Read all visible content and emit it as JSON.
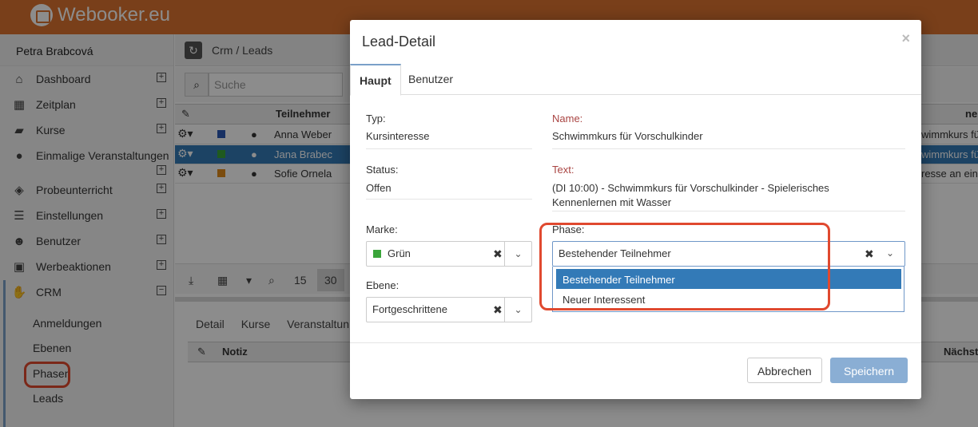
{
  "app": {
    "logo_text": "Webooker.eu"
  },
  "sidebar": {
    "user_name": "Petra Brabcová",
    "items": [
      {
        "label": "Dashboard",
        "icon": "home-icon"
      },
      {
        "label": "Zeitplan",
        "icon": "calendar-icon"
      },
      {
        "label": "Kurse",
        "icon": "book-icon"
      },
      {
        "label": "Einmalige Veranstaltungen",
        "icon": "soccer-ball-icon"
      },
      {
        "label": "Probeunterricht",
        "icon": "eye-slash-icon"
      },
      {
        "label": "Einstellungen",
        "icon": "list-icon"
      },
      {
        "label": "Benutzer",
        "icon": "users-icon"
      },
      {
        "label": "Werbeaktionen",
        "icon": "gift-icon"
      },
      {
        "label": "CRM",
        "icon": "handshake-icon"
      }
    ],
    "crm_subitems": [
      "Anmeldungen",
      "Ebenen",
      "Phasen",
      "Leads"
    ]
  },
  "content": {
    "breadcrumb": "Crm / Leads",
    "search_placeholder": "Suche",
    "grid": {
      "col_participant": "Teilnehmer",
      "col_name_partial": "ne",
      "rows": [
        {
          "name": "Anna Weber",
          "right": "wimmkurs fü",
          "flag_color": "#2a58b5"
        },
        {
          "name": "Jana Brabec",
          "right": "wimmkurs fü",
          "flag_color": "#3aa53a"
        },
        {
          "name": "Sofie Ornela",
          "right": "resse an ein",
          "flag_color": "#e08a1a"
        }
      ]
    },
    "pager": {
      "page_sizes": [
        "15",
        "30"
      ]
    },
    "bottom_tabs": [
      "Detail",
      "Kurse",
      "Veranstaltun"
    ],
    "bottom_grid": {
      "col_note": "Notiz",
      "col_next": "Nächst"
    }
  },
  "modal": {
    "title": "Lead-Detail",
    "close": "×",
    "tabs": [
      "Haupt",
      "Benutzer"
    ],
    "typ_label": "Typ:",
    "typ_value": "Kursinteresse",
    "name_label": "Name:",
    "name_value": "Schwimmkurs für Vorschulkinder",
    "status_label": "Status:",
    "status_value": "Offen",
    "text_label": "Text:",
    "text_value": "(DI 10:00) - Schwimmkurs für Vorschulkinder - Spielerisches Kennenlernen mit Wasser",
    "marke_label": "Marke:",
    "marke_value": "Grün",
    "marke_flag_color": "#3aa53a",
    "ebene_label": "Ebene:",
    "ebene_value": "Fortgeschrittene",
    "phase_label": "Phase:",
    "phase_value": "Bestehender Teilnehmer",
    "phase_options": [
      "Bestehender Teilnehmer",
      "Neuer Interessent"
    ],
    "cancel_label": "Abbrechen",
    "save_label": "Speichern"
  },
  "colors": {
    "header": "#dd7430",
    "primary": "#337ab7",
    "annotation": "#e0492f"
  }
}
